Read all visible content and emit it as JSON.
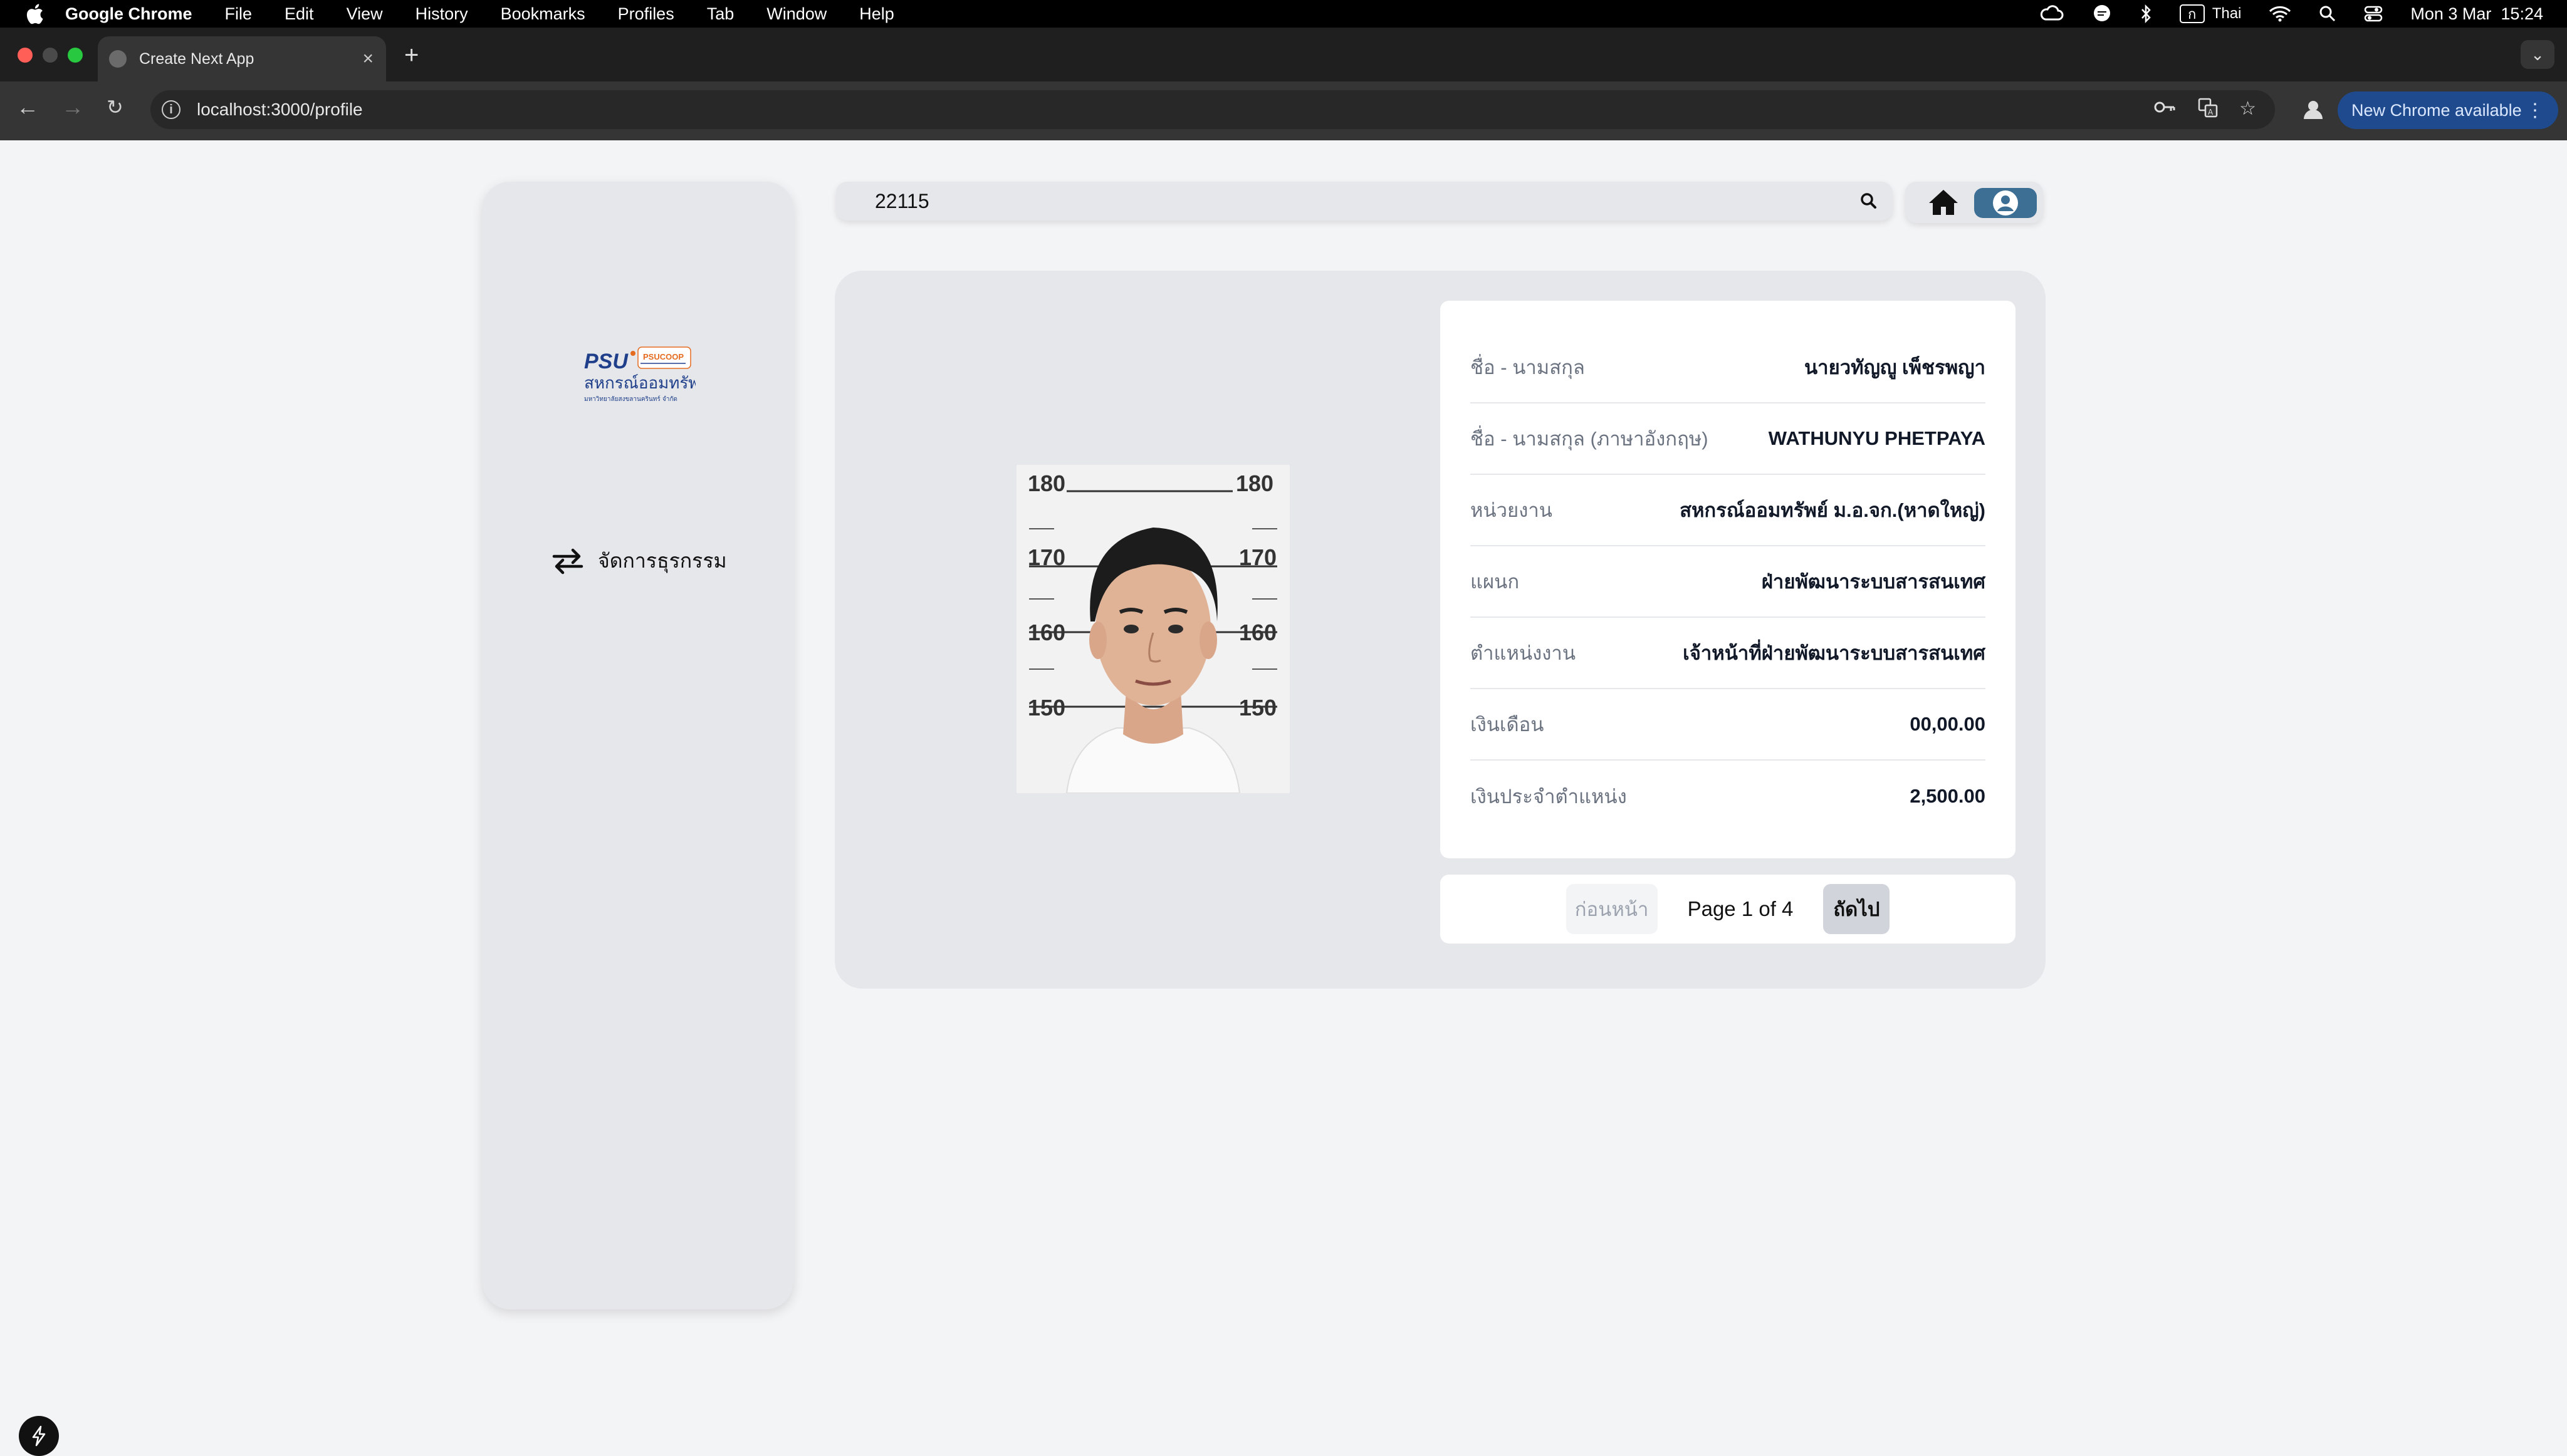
{
  "menubar": {
    "app_name": "Google Chrome",
    "menus": [
      "File",
      "Edit",
      "View",
      "History",
      "Bookmarks",
      "Profiles",
      "Tab",
      "Window",
      "Help"
    ],
    "input_source": "Thai",
    "input_key": "ก",
    "datetime": "Mon 3 Mar  15:24"
  },
  "browser": {
    "tab_title": "Create Next App",
    "url": "localhost:3000/profile",
    "update_label": "New Chrome available"
  },
  "logo": {
    "brand_top": "PSU",
    "brand_small": "PSUCOOP",
    "brand_thai": "สหกรณ์ออมทรัพย์",
    "brand_sub": "มหาวิทยาลัยสงขลานครินทร์ จำกัด"
  },
  "sidebar": {
    "items": [
      {
        "label": "จัดการธุรกรรม",
        "icon": "transfer-arrows-icon"
      }
    ]
  },
  "search": {
    "value": "22115"
  },
  "profile": {
    "rows": [
      {
        "label": "ชื่อ - นามสกุล",
        "value": "นายวทัญญู เพ็ชรพญา"
      },
      {
        "label": "ชื่อ - นามสกุล (ภาษาอังกฤษ)",
        "value": "WATHUNYU PHETPAYA"
      },
      {
        "label": "หน่วยงาน",
        "value": "สหกรณ์ออมทรัพย์ ม.อ.จก.(หาดใหญ่)"
      },
      {
        "label": "แผนก",
        "value": "ฝ่ายพัฒนาระบบสารสนเทศ"
      },
      {
        "label": "ตำแหน่งงาน",
        "value": "เจ้าหน้าที่ฝ่ายพัฒนาระบบสารสนเทศ"
      },
      {
        "label": "เงินเดือน",
        "value": "00,00.00"
      },
      {
        "label": "เงินประจำตำแหน่ง",
        "value": "2,500.00"
      }
    ],
    "photo_marks": [
      "180",
      "170",
      "160",
      "150"
    ]
  },
  "pagination": {
    "prev_label": "ก่อนหน้า",
    "page_info": "Page 1 of 4",
    "next_label": "ถัดไป"
  },
  "colors": {
    "accent": "#3d6e94",
    "update_pill": "#1f4b8e"
  }
}
